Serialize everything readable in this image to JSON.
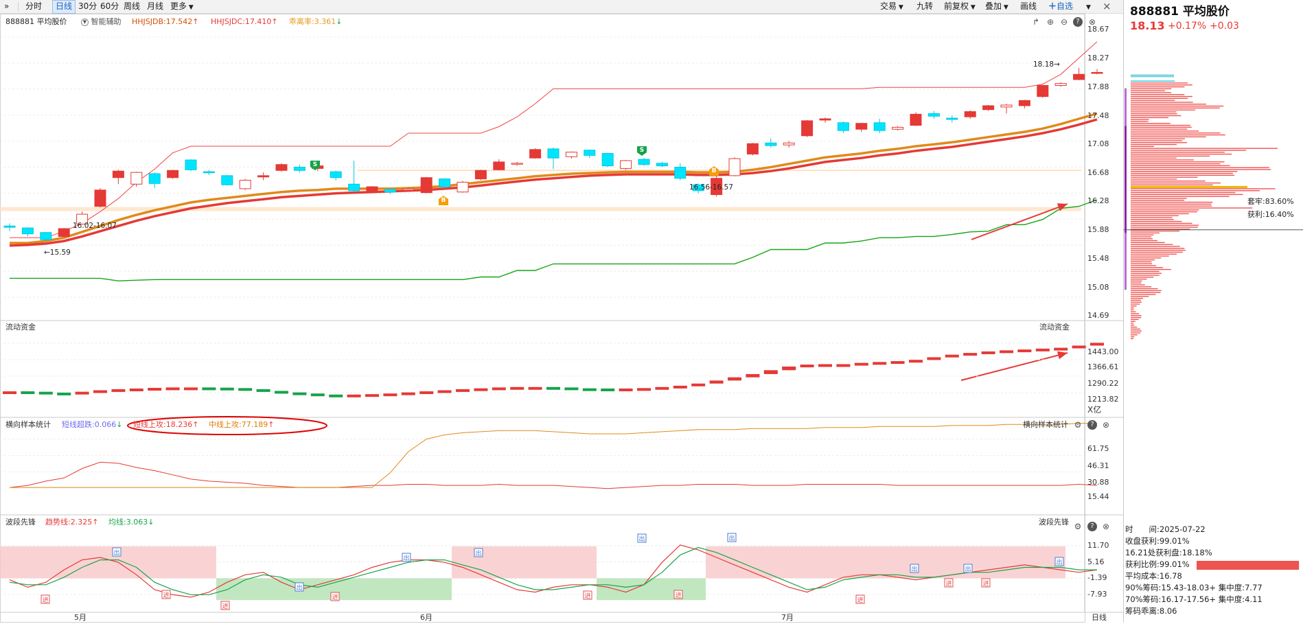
{
  "toolbar": {
    "collapse_icon": "double-chevron-right-icon",
    "tabs": [
      "分时",
      "日线",
      "30分",
      "60分",
      "周线",
      "月线",
      "更多"
    ],
    "selected": "日线",
    "right_buttons": [
      "交易",
      "九转",
      "前复权",
      "叠加",
      "画线"
    ],
    "watchlist_label": "自选",
    "close_label": "×"
  },
  "main_panel": {
    "title": "888881 平均股价",
    "assist_label": "智能辅助",
    "indicators": [
      {
        "label": "HHJSJDB:17.542",
        "arrow": "↑",
        "color": "#d64f05"
      },
      {
        "label": "HHJSJDC:17.410",
        "arrow": "↑",
        "color": "#e53935"
      },
      {
        "label": "乖离率:3.361",
        "arrow": "↓",
        "color": "#e59a1e"
      }
    ],
    "y_ticks": [
      "18.67",
      "18.27",
      "17.88",
      "17.48",
      "17.08",
      "16.68",
      "16.28",
      "15.88",
      "15.48",
      "15.08",
      "14.69"
    ],
    "annotations": {
      "left_range": "16.02-16.07",
      "low": "←15.59",
      "mid_range": "16.56-16.57",
      "high": "18.18→"
    },
    "signals": {
      "s": "S",
      "b": "B"
    }
  },
  "flow_panel": {
    "title": "流动资金",
    "title_right": "流动资金",
    "y_ticks": [
      "1443.00",
      "1366.61",
      "1290.22",
      "1213.82"
    ],
    "unit": "X亿"
  },
  "stats_panel": {
    "title": "横向样本统计",
    "title_right": "横向样本统计",
    "items": [
      {
        "label": "短线超跌:0.066",
        "arrow": "↓",
        "color": "#6b6bf0"
      },
      {
        "label": "短线上攻:18.236",
        "arrow": "↑",
        "color": "#e53935"
      },
      {
        "label": "中线上攻:77.189",
        "arrow": "↑",
        "color": "#e07b00"
      }
    ],
    "y_ticks": [
      "61.75",
      "46.31",
      "30.88",
      "15.44"
    ]
  },
  "wave_panel": {
    "title": "波段先锋",
    "title_right": "波段先锋",
    "items": [
      {
        "label": "趋势线:2.325",
        "arrow": "↑",
        "color": "#e53935"
      },
      {
        "label": "均线:3.063",
        "arrow": "↓",
        "color": "#16a34a"
      }
    ],
    "y_ticks": [
      "11.70",
      "5.16",
      "-1.39",
      "-7.93"
    ],
    "marker_out": "出",
    "marker_in": "进"
  },
  "x_axis": {
    "months": [
      "5月",
      "6月",
      "7月"
    ],
    "period": "日线"
  },
  "chip_panel": {
    "title": "888881 平均股价",
    "price": "18.13",
    "change_pct": "+0.17%",
    "change": "+0.03",
    "trapped_label": "套牢:83.60%",
    "profit_label": "获利:16.40%",
    "stats": [
      "时　　间:2025-07-22",
      "收盘获利:99.01%",
      "16.21处获利盘:18.18%",
      "获利比例:99.01%",
      "平均成本:16.78",
      "90%筹码:15.43-18.03+ 集中度:7.77",
      "70%筹码:16.17-17.56+ 集中度:4.11",
      "筹码乖离:8.06"
    ],
    "profit_ratio": 0.9901
  },
  "colors": {
    "up": "#e53935",
    "down": "#00e5ff",
    "orange": "#e08a1a",
    "green": "#14a01a"
  },
  "chart_data": {
    "type": "candlestick",
    "title": "888881 平均股价",
    "ylim": [
      14.69,
      18.67
    ],
    "candles": [
      [
        15.78,
        15.76,
        15.82,
        15.7
      ],
      [
        15.75,
        15.66,
        15.76,
        15.62
      ],
      [
        15.68,
        15.57,
        15.69,
        15.55
      ],
      [
        15.62,
        15.74,
        15.75,
        15.6
      ],
      [
        15.81,
        15.96,
        16.0,
        15.8
      ],
      [
        16.08,
        16.33,
        16.36,
        16.06
      ],
      [
        16.52,
        16.62,
        16.64,
        16.42
      ],
      [
        16.42,
        16.6,
        16.61,
        16.38
      ],
      [
        16.58,
        16.43,
        16.6,
        16.36
      ],
      [
        16.52,
        16.63,
        16.64,
        16.5
      ],
      [
        16.79,
        16.64,
        16.8,
        16.62
      ],
      [
        16.61,
        16.6,
        16.64,
        16.56
      ],
      [
        16.55,
        16.41,
        16.56,
        16.4
      ],
      [
        16.35,
        16.48,
        16.5,
        16.33
      ],
      [
        16.53,
        16.55,
        16.6,
        16.48
      ],
      [
        16.63,
        16.72,
        16.74,
        16.61
      ],
      [
        16.68,
        16.63,
        16.72,
        16.6
      ],
      [
        16.66,
        16.7,
        16.72,
        16.62
      ],
      [
        16.61,
        16.52,
        16.63,
        16.48
      ],
      [
        16.42,
        16.32,
        16.78,
        16.3
      ],
      [
        16.3,
        16.38,
        16.39,
        16.28
      ],
      [
        16.34,
        16.3,
        16.36,
        16.27
      ],
      [
        16.33,
        16.35,
        16.37,
        16.31
      ],
      [
        16.29,
        16.52,
        16.53,
        16.28
      ],
      [
        16.5,
        16.38,
        16.51,
        16.36
      ],
      [
        16.3,
        16.45,
        16.47,
        16.29
      ],
      [
        16.5,
        16.63,
        16.64,
        16.48
      ],
      [
        16.64,
        16.76,
        16.8,
        16.63
      ],
      [
        16.73,
        16.74,
        16.76,
        16.7
      ],
      [
        16.82,
        16.95,
        16.97,
        16.81
      ],
      [
        16.96,
        16.82,
        16.98,
        16.65
      ],
      [
        16.84,
        16.91,
        16.92,
        16.81
      ],
      [
        16.94,
        16.86,
        16.95,
        16.82
      ],
      [
        16.89,
        16.7,
        16.9,
        16.68
      ],
      [
        16.66,
        16.78,
        16.79,
        16.64
      ],
      [
        16.8,
        16.72,
        16.82,
        16.7
      ],
      [
        16.74,
        16.7,
        16.76,
        16.68
      ],
      [
        16.68,
        16.51,
        16.74,
        16.48
      ],
      [
        16.41,
        16.32,
        16.43,
        16.28
      ],
      [
        16.26,
        16.51,
        16.54,
        16.23
      ],
      [
        16.55,
        16.81,
        16.83,
        16.54
      ],
      [
        16.88,
        17.04,
        17.05,
        16.86
      ],
      [
        17.05,
        17.01,
        17.12,
        16.98
      ],
      [
        17.02,
        17.05,
        17.08,
        16.98
      ],
      [
        17.16,
        17.39,
        17.4,
        17.14
      ],
      [
        17.4,
        17.42,
        17.44,
        17.36
      ],
      [
        17.36,
        17.24,
        17.38,
        17.2
      ],
      [
        17.26,
        17.35,
        17.36,
        17.22
      ],
      [
        17.36,
        17.24,
        17.42,
        17.2
      ],
      [
        17.26,
        17.29,
        17.31,
        17.24
      ],
      [
        17.32,
        17.49,
        17.52,
        17.31
      ],
      [
        17.5,
        17.46,
        17.54,
        17.42
      ],
      [
        17.43,
        17.41,
        17.47,
        17.36
      ],
      [
        17.45,
        17.53,
        17.55,
        17.42
      ],
      [
        17.56,
        17.62,
        17.63,
        17.54
      ],
      [
        17.6,
        17.63,
        17.65,
        17.5
      ],
      [
        17.62,
        17.7,
        17.71,
        17.58
      ],
      [
        17.76,
        17.93,
        17.94,
        17.74
      ],
      [
        17.93,
        17.96,
        17.98,
        17.91
      ],
      [
        18.02,
        18.1,
        18.2,
        18.01
      ],
      [
        18.13,
        18.13,
        18.18,
        18.1
      ]
    ],
    "line_orange": [
      15.52,
      15.52,
      15.55,
      15.6,
      15.69,
      15.78,
      15.87,
      15.95,
      16.02,
      16.08,
      16.14,
      16.18,
      16.21,
      16.24,
      16.27,
      16.3,
      16.32,
      16.33,
      16.35,
      16.35,
      16.35,
      16.35,
      16.36,
      16.37,
      16.39,
      16.42,
      16.45,
      16.48,
      16.51,
      16.54,
      16.56,
      16.58,
      16.59,
      16.6,
      16.61,
      16.61,
      16.61,
      16.61,
      16.6,
      16.6,
      16.61,
      16.64,
      16.68,
      16.73,
      16.78,
      16.83,
      16.86,
      16.89,
      16.93,
      16.96,
      17.0,
      17.03,
      17.06,
      17.1,
      17.14,
      17.18,
      17.22,
      17.27,
      17.34,
      17.42,
      17.5
    ],
    "line_red": [
      15.48,
      15.49,
      15.51,
      15.55,
      15.62,
      15.7,
      15.78,
      15.86,
      15.93,
      15.99,
      16.05,
      16.09,
      16.13,
      16.16,
      16.19,
      16.22,
      16.24,
      16.26,
      16.28,
      16.29,
      16.3,
      16.31,
      16.32,
      16.33,
      16.35,
      16.37,
      16.4,
      16.43,
      16.46,
      16.49,
      16.51,
      16.53,
      16.55,
      16.56,
      16.57,
      16.57,
      16.57,
      16.57,
      16.56,
      16.56,
      16.57,
      16.59,
      16.62,
      16.66,
      16.71,
      16.76,
      16.79,
      16.82,
      16.86,
      16.89,
      16.93,
      16.96,
      16.99,
      17.03,
      17.07,
      17.11,
      17.15,
      17.2,
      17.26,
      17.33,
      17.41
    ],
    "upper_band": [
      15.6,
      15.6,
      15.6,
      15.7,
      15.82,
      16.0,
      16.2,
      16.45,
      16.65,
      16.9,
      17.0,
      17.0,
      17.0,
      17.0,
      17.0,
      17.0,
      17.0,
      17.0,
      17.0,
      17.0,
      17.0,
      17.0,
      17.2,
      17.2,
      17.2,
      17.2,
      17.2,
      17.3,
      17.45,
      17.65,
      17.88,
      17.88,
      17.88,
      17.88,
      17.88,
      17.88,
      17.88,
      17.88,
      17.88,
      17.88,
      17.88,
      17.88,
      17.88,
      17.88,
      17.88,
      17.88,
      17.88,
      17.88,
      17.9,
      17.9,
      17.9,
      17.9,
      17.9,
      17.9,
      17.9,
      17.9,
      17.9,
      17.95,
      18.1,
      18.35,
      18.6
    ],
    "lower_band": [
      14.98,
      14.98,
      14.98,
      14.98,
      14.98,
      14.98,
      14.94,
      14.95,
      14.96,
      14.96,
      14.96,
      14.96,
      14.96,
      14.96,
      14.96,
      14.96,
      14.96,
      14.96,
      14.96,
      14.96,
      14.96,
      14.96,
      14.96,
      14.96,
      14.96,
      14.96,
      15.0,
      15.0,
      15.1,
      15.1,
      15.2,
      15.2,
      15.2,
      15.2,
      15.2,
      15.2,
      15.2,
      15.2,
      15.2,
      15.2,
      15.2,
      15.3,
      15.42,
      15.42,
      15.42,
      15.52,
      15.52,
      15.55,
      15.6,
      15.6,
      15.62,
      15.62,
      15.65,
      15.69,
      15.7,
      15.8,
      15.8,
      15.88,
      16.05,
      16.08,
      16.18
    ],
    "flow": [
      1220,
      1218,
      1214,
      1212,
      1218,
      1225,
      1230,
      1233,
      1236,
      1238,
      1238,
      1237,
      1235,
      1230,
      1222,
      1215,
      1210,
      1205,
      1204,
      1205,
      1207,
      1210,
      1215,
      1220,
      1225,
      1230,
      1234,
      1238,
      1240,
      1240,
      1238,
      1234,
      1233,
      1232,
      1233,
      1235,
      1240,
      1246,
      1256,
      1270,
      1285,
      1300,
      1318,
      1335,
      1344,
      1346,
      1346,
      1352,
      1356,
      1360,
      1366,
      1378,
      1390,
      1398,
      1405,
      1410,
      1414,
      1418,
      1422,
      1432,
      1445
    ],
    "stats_short": [
      16,
      18,
      22,
      25,
      34,
      40,
      39,
      35,
      32,
      28,
      24,
      22,
      21,
      20,
      18,
      17,
      16,
      16,
      16,
      17,
      18,
      18,
      19,
      19,
      18,
      18,
      18,
      19,
      18,
      18,
      18,
      17,
      16,
      15,
      16,
      17,
      18,
      18,
      19,
      19,
      19,
      18,
      18,
      18,
      19,
      19,
      19,
      19,
      19,
      18,
      18,
      18,
      18,
      18,
      18,
      18,
      18,
      18,
      18,
      19,
      18
    ],
    "stats_mid": [
      16,
      16,
      16,
      16,
      16,
      16,
      16,
      16,
      16,
      16,
      16,
      16,
      16,
      16,
      16,
      16,
      16,
      16,
      16,
      16,
      16,
      30,
      50,
      62,
      66,
      68,
      69,
      70,
      70,
      70,
      69,
      68,
      67,
      67,
      67,
      68,
      69,
      70,
      71,
      71,
      71,
      72,
      72,
      72,
      72,
      73,
      73,
      73,
      74,
      74,
      74,
      74,
      75,
      75,
      75,
      76,
      76,
      76,
      76,
      77,
      77
    ],
    "wave_trend": [
      -2,
      -5,
      -3,
      2,
      6,
      7,
      5,
      0,
      -6,
      -8,
      -9,
      -7,
      -3,
      0,
      1,
      -3,
      -6,
      -4,
      -2,
      0,
      3,
      5,
      6,
      6,
      5,
      3,
      0,
      -3,
      -6,
      -7,
      -5,
      -4,
      -4,
      -5,
      -7,
      -4,
      5,
      12,
      10,
      7,
      4,
      1,
      -2,
      -5,
      -7,
      -4,
      -1,
      0,
      0,
      -1,
      -2,
      -1,
      0,
      1,
      2,
      3,
      4,
      3,
      2,
      1,
      2
    ],
    "wave_avg": [
      -3,
      -4,
      -4,
      -1,
      3,
      6,
      6,
      3,
      -3,
      -6,
      -8,
      -8,
      -6,
      -2,
      0,
      -1,
      -4,
      -5,
      -3,
      -1,
      1,
      3,
      5,
      6,
      6,
      4,
      2,
      -1,
      -4,
      -6,
      -6,
      -5,
      -4,
      -4,
      -5,
      -4,
      1,
      8,
      11,
      9,
      6,
      3,
      0,
      -3,
      -6,
      -5,
      -2,
      -1,
      0,
      0,
      -1,
      -1,
      0,
      1,
      1,
      2,
      3,
      3,
      3,
      2,
      2
    ],
    "wave_ylim": [
      -11,
      14
    ]
  }
}
